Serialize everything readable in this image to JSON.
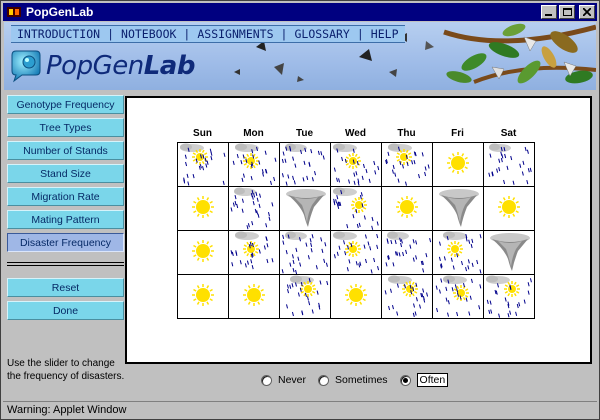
{
  "window": {
    "title": "PopGenLab"
  },
  "nav": [
    "INTRODUCTION",
    "NOTEBOOK",
    "ASSIGNMENTS",
    "GLOSSARY",
    "HELP"
  ],
  "logo": {
    "text_light": "PopGen",
    "text_bold": "Lab"
  },
  "sidebar": {
    "buttons": [
      {
        "label": "Genotype Frequency",
        "active": false
      },
      {
        "label": "Tree Types",
        "active": false
      },
      {
        "label": "Number of Stands",
        "active": false
      },
      {
        "label": "Stand Size",
        "active": false
      },
      {
        "label": "Migration Rate",
        "active": false
      },
      {
        "label": "Mating Pattern",
        "active": false
      },
      {
        "label": "Disaster Frequency",
        "active": true
      }
    ],
    "reset_label": "Reset",
    "done_label": "Done",
    "help_text": "Use the slider to change the frequency of disasters."
  },
  "calendar": {
    "days": [
      "Sun",
      "Mon",
      "Tue",
      "Wed",
      "Thu",
      "Fri",
      "Sat"
    ],
    "rows": [
      [
        "storm",
        "storm",
        "rain",
        "storm",
        "storm",
        "sun",
        "rain"
      ],
      [
        "sun",
        "rain",
        "tornado",
        "storm",
        "sun",
        "tornado",
        "sun"
      ],
      [
        "sun",
        "storm",
        "rain",
        "storm",
        "rain",
        "storm",
        "tornado"
      ],
      [
        "sun",
        "sun",
        "storm",
        "sun",
        "storm",
        "storm",
        "storm"
      ]
    ]
  },
  "frequency": {
    "options": [
      "Never",
      "Sometimes",
      "Often"
    ],
    "selected": "Often"
  },
  "status": {
    "text": "Warning: Applet Window"
  },
  "colors": {
    "title_bar": "#000080",
    "sidebar_button": "#7ad6ea",
    "rain": "#00008b",
    "sun": "#ffe000"
  }
}
